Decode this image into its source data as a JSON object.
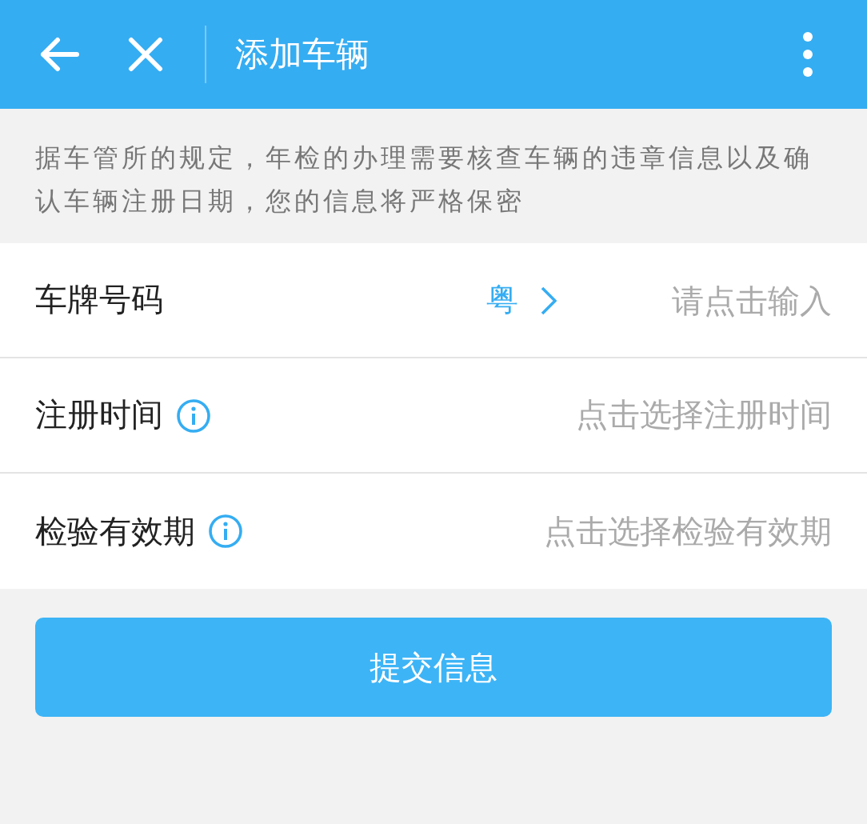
{
  "header": {
    "title": "添加车辆"
  },
  "notice": "据车管所的规定，年检的办理需要核查车辆的违章信息以及确认车辆注册日期，您的信息将严格保密",
  "fields": [
    {
      "kind": "plate",
      "label": "车牌号码",
      "info": false,
      "province": "粤",
      "placeholder": "请点击输入"
    },
    {
      "kind": "picker",
      "label": "注册时间",
      "info": true,
      "placeholder": "点击选择注册时间"
    },
    {
      "kind": "picker",
      "label": "检验有效期",
      "info": true,
      "placeholder": "点击选择检验有效期"
    }
  ],
  "submit": "提交信息"
}
